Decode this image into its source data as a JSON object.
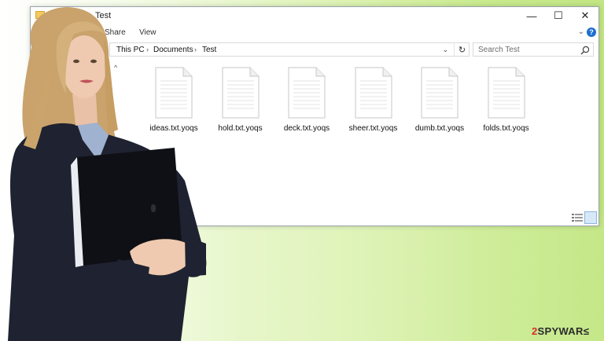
{
  "window": {
    "title": "Test",
    "minimize_glyph": "—",
    "maximize_glyph": "☐",
    "close_glyph": "✕"
  },
  "ribbon": {
    "tabs": [
      "Share",
      "View"
    ],
    "help_glyph": "?"
  },
  "address": {
    "breadcrumb": [
      "This PC",
      "Documents",
      "Test"
    ]
  },
  "search": {
    "placeholder": "Search Test"
  },
  "files": [
    "ideas.txt.yoqs",
    "hold.txt.yoqs",
    "deck.txt.yoqs",
    "sheer.txt.yoqs",
    "dumb.txt.yoqs",
    "folds.txt.yoqs"
  ],
  "watermark": {
    "number": "2",
    "text": "SPYWAR"
  },
  "colors": {
    "background_green": "#c9ea8e",
    "folder_yellow": "#f4c95d",
    "help_blue": "#1c6fce",
    "watermark_red": "#d92b2b"
  }
}
